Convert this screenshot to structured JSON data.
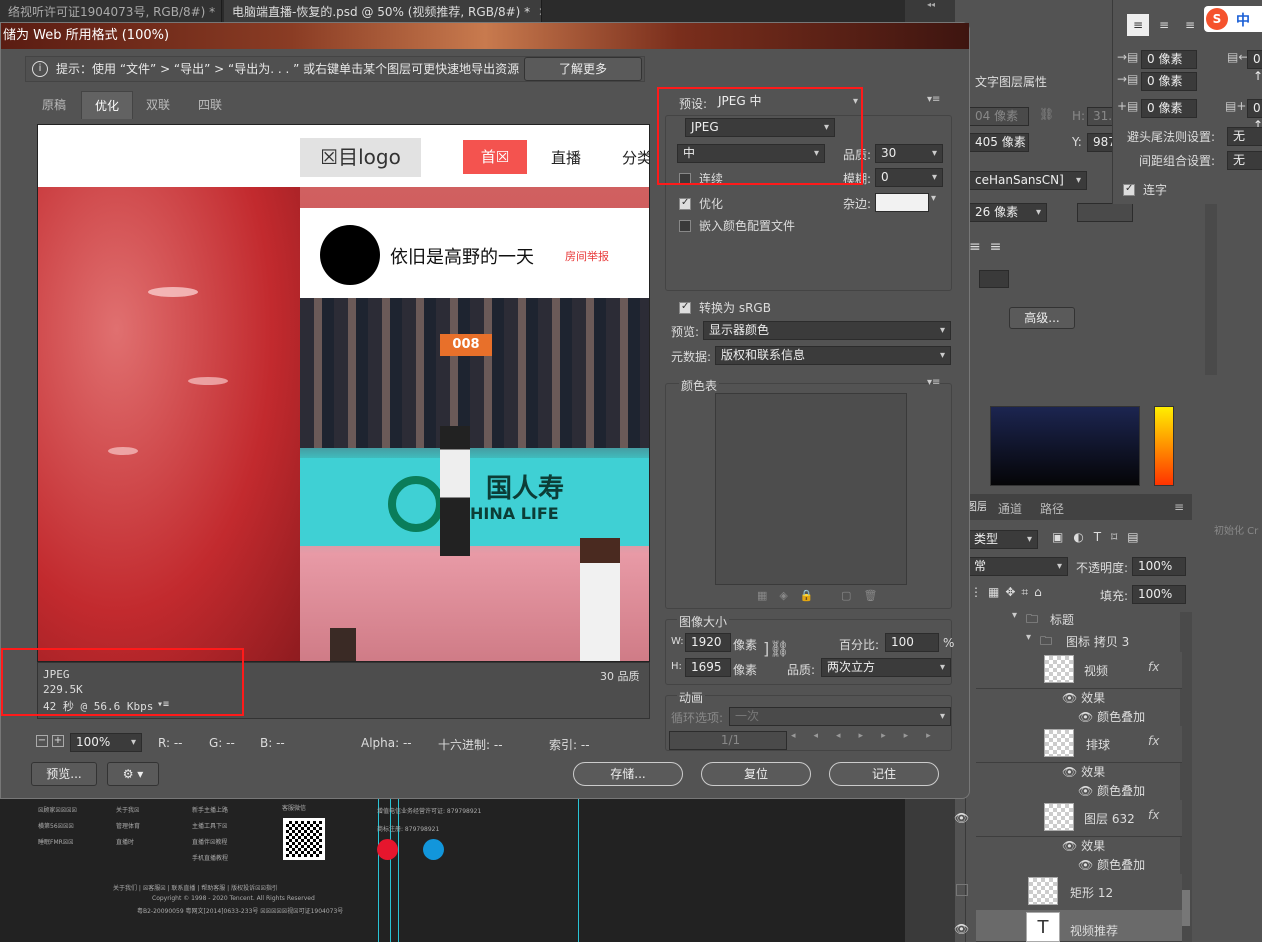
{
  "doc_tabs": [
    {
      "label": "络视听许可证1904073号, RGB/8#) *",
      "close": "✕"
    },
    {
      "label": "电脑端直播-恢复的.psd @ 50% (视频推荐, RGB/8#) *",
      "close": "✕"
    }
  ],
  "dialog": {
    "title": "储为 Web 所用格式 (100%)",
    "tip": "提示：使用 “文件” > “导出” > “导出为. . . ” 或右键单击某个图层可更快速地导出资源",
    "learn_more": "了解更多",
    "view_tabs": [
      "原稿",
      "优化",
      "双联",
      "四联"
    ],
    "active_view": "优化"
  },
  "preview": {
    "logo": "☒目logo",
    "nav": [
      "首☒",
      "直播",
      "分类"
    ],
    "streamer": "依旧是高野的一天",
    "report": "房间举报",
    "jersey": "008",
    "banner": "国人寿",
    "banner2": "HINA LIFE",
    "status": {
      "format": "JPEG",
      "size": "229.5K",
      "time": "42 秒 @ 56.6 Kbps",
      "quality": "30 品质"
    }
  },
  "settings": {
    "preset_label": "预设:",
    "preset": "JPEG 中",
    "format": "JPEG",
    "compression": "中",
    "quality_label": "品质:",
    "quality": "30",
    "progressive": "连续",
    "blur_label": "模糊:",
    "blur": "0",
    "optimize": "优化",
    "matte_label": "杂边:",
    "embed_profile": "嵌入颜色配置文件",
    "srgb": "转换为 sRGB",
    "preview_label": "预览:",
    "preview_val": "显示器颜色",
    "meta_label": "元数据:",
    "meta_val": "版权和联系信息",
    "color_table": "颜色表",
    "image_size": "图像大小",
    "w_label": "W:",
    "w": "1920",
    "w_unit": "像素",
    "h_label": "H:",
    "h": "1695",
    "h_unit": "像素",
    "percent_label": "百分比:",
    "percent": "100",
    "percent_unit": "%",
    "resample_label": "品质:",
    "resample": "两次立方",
    "animation": "动画",
    "loop_label": "循环选项:",
    "loop": "一次",
    "frame": "1/1"
  },
  "bottom": {
    "zoom": "100%",
    "r": "R: --",
    "g": "G: --",
    "b": "B: --",
    "alpha": "Alpha: --",
    "hex": "十六进制: --",
    "index": "索引: --",
    "preview_btn": "预览...",
    "save": "存储...",
    "reset": "复位",
    "remember": "记住"
  },
  "char_panel": {
    "space1": "0 像素",
    "space2": "0 像素",
    "space3": "0 像素",
    "r1": "0 ↑",
    "r2": "0 ↑",
    "kinsoku_label": "避头尾法则设置:",
    "kinsoku": "无",
    "mojikumi_label": "间距组合设置:",
    "mojikumi": "无",
    "ligature": "连字"
  },
  "props": {
    "title": "文字图层属性",
    "w_px": "04 像素",
    "x_px": "405 像素",
    "y_label": "Y:",
    "y": "987",
    "h_label": "H:",
    "h": "31.6",
    "font": "ceHanSansCN]",
    "size": "26 像素",
    "advanced": "高级..."
  },
  "ime": {
    "logo": "S",
    "lang": "中"
  },
  "init_text": "初始化 Cr",
  "layers": {
    "tabs": [
      "图层",
      "通道",
      "路径"
    ],
    "filter": "类型",
    "blend": "常",
    "opacity_label": "不透明度:",
    "opacity": "100%",
    "fill_label": "填充:",
    "fill": "100%",
    "rows": [
      {
        "name": "标题",
        "kind": "folder"
      },
      {
        "name": "图标 拷贝 3",
        "kind": "folder"
      },
      {
        "name": "视频",
        "kind": "smart",
        "fx": "fx"
      },
      {
        "name": "效果",
        "kind": "effect"
      },
      {
        "name": "颜色叠加",
        "kind": "effect"
      },
      {
        "name": "排球",
        "kind": "smart",
        "fx": "fx"
      },
      {
        "name": "效果",
        "kind": "effect"
      },
      {
        "name": "颜色叠加",
        "kind": "effect"
      },
      {
        "name": "图层 632",
        "kind": "smart",
        "fx": "fx"
      },
      {
        "name": "效果",
        "kind": "effect"
      },
      {
        "name": "颜色叠加",
        "kind": "effect"
      },
      {
        "name": "矩形 12",
        "kind": "shape"
      },
      {
        "name": "视频推荐",
        "kind": "text"
      }
    ]
  },
  "canvas_footer": {
    "col1": [
      "☒顾家☒☒☒☒",
      "横第56☒☒☒",
      "睡眠FMR☒☒"
    ],
    "col2": [
      "关于我☒",
      "管理体育",
      "直播时"
    ],
    "col3": [
      "新手主播上路",
      "主播工具下☒",
      "直播伴☒教程",
      "手机直播教程"
    ],
    "col4": "客服微信",
    "col5": [
      "增值电信业务经营许可证: 879798921",
      "商标注册: 879798921"
    ],
    "links": "关于我们  |  ☒客服☒  |  联系直播  |  帮助客服  |  版权投诉☒☒指引",
    "copyright": "Copyright © 1998 - 2020 Tencent. All Rights Reserved",
    "icp": "粤B2-20090059  粤网文[2014]0633-233号  ☒☒☒☒☒视☒可证1904073号"
  }
}
